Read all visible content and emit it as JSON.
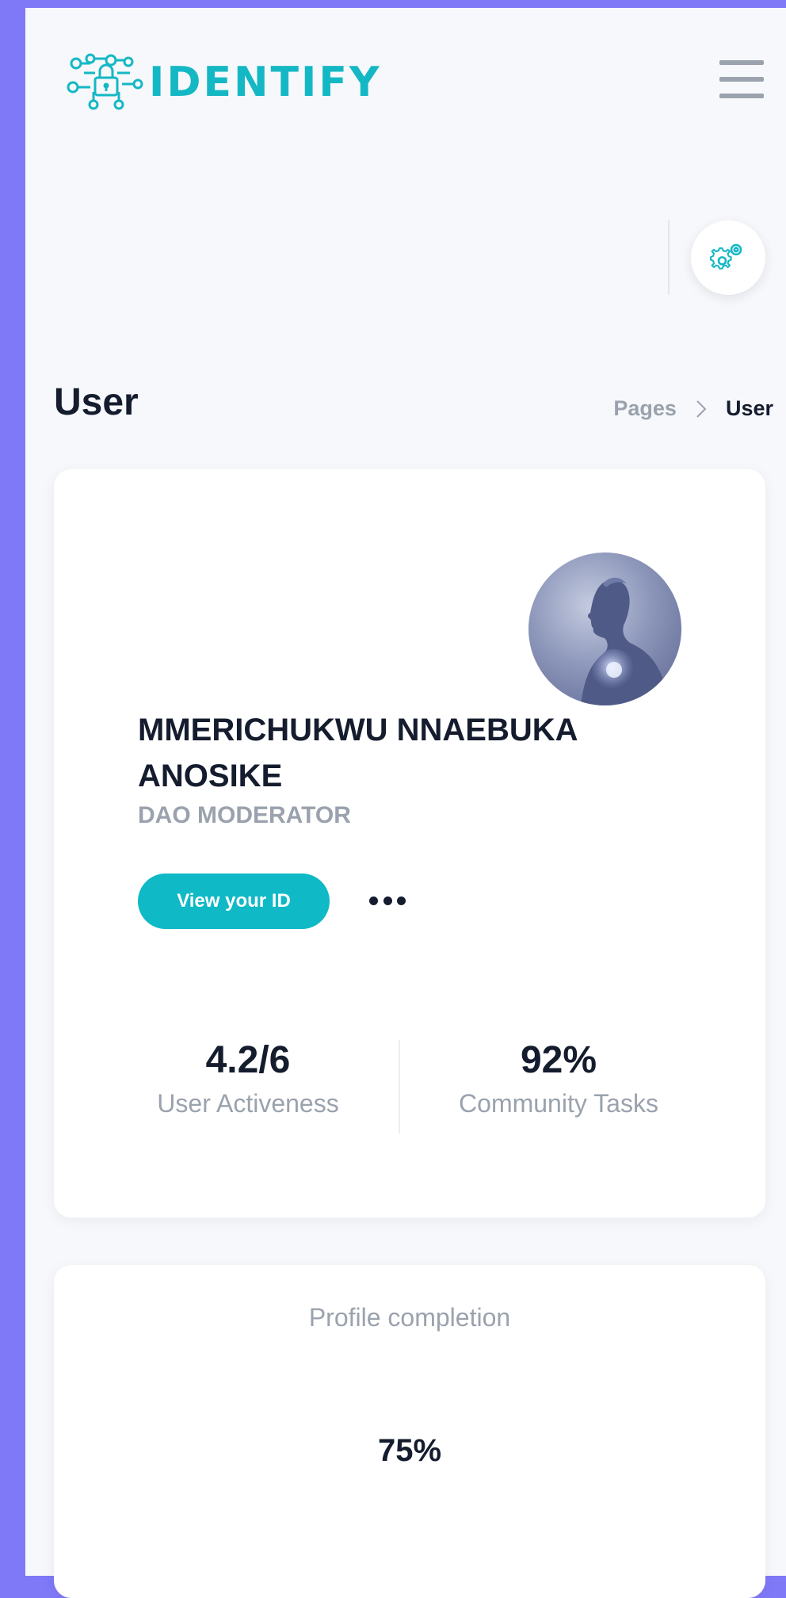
{
  "brand": {
    "name": "IDENTIFY",
    "accent_color": "#14b8c4"
  },
  "header": {
    "menu_icon": "hamburger-menu-icon",
    "settings_icon": "gears-icon"
  },
  "page": {
    "title": "User"
  },
  "breadcrumb": {
    "items": [
      "Pages",
      "User"
    ],
    "separator_icon": "chevron-right-icon"
  },
  "profile": {
    "name": "MMERICHUKWU NNAEBUKA ANOSIKE",
    "role": "DAO MODERATOR",
    "view_id_label": "View your ID",
    "more_icon": "more-dots-icon"
  },
  "stats": [
    {
      "value": "4.2/6",
      "label": "User Activeness"
    },
    {
      "value": "92%",
      "label": "Community Tasks"
    }
  ],
  "completion": {
    "title": "Profile completion",
    "value": "75%"
  },
  "colors": {
    "page_frame": "#8079f7",
    "button": "#0fb9c6",
    "text_dark": "#141c2e",
    "text_muted": "#9aa2ad"
  }
}
